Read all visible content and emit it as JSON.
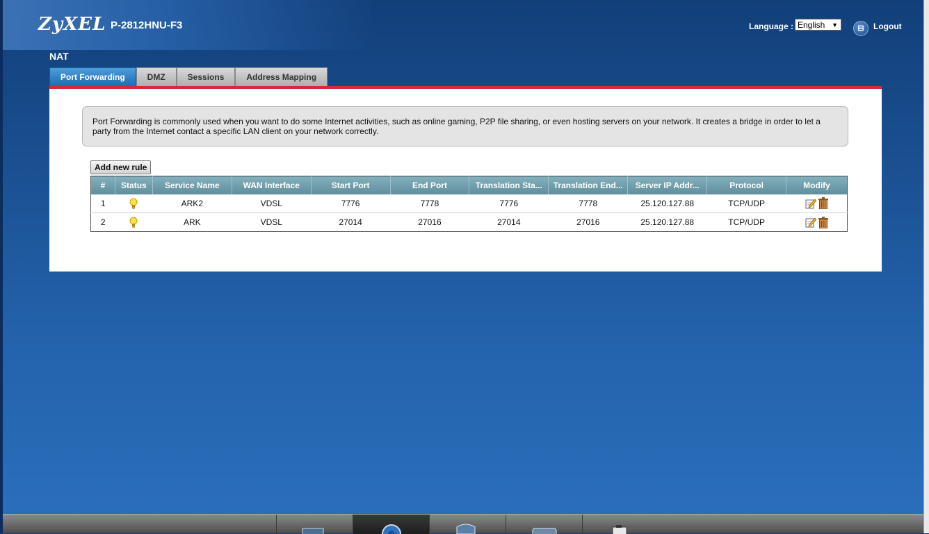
{
  "header": {
    "logo": "ZyXEL",
    "model": "P-2812HNU-F3",
    "language_label": "Language :",
    "language_value": "English",
    "logout_label": "Logout",
    "logout_icon_glyph": "⊟"
  },
  "page_title": "NAT",
  "tabs": [
    {
      "label": "Port Forwarding",
      "active": true
    },
    {
      "label": "DMZ",
      "active": false
    },
    {
      "label": "Sessions",
      "active": false
    },
    {
      "label": "Address Mapping",
      "active": false
    }
  ],
  "info_text": "Port Forwarding is commonly used when you want to do some Internet activities, such as online gaming, P2P file sharing, or even hosting servers on your network. It creates a bridge in order to let a party from the Internet contact a specific LAN client on your network correctly.",
  "add_button_label": "Add new rule",
  "table": {
    "columns": [
      "#",
      "Status",
      "Service Name",
      "WAN Interface",
      "Start Port",
      "End Port",
      "Translation Sta...",
      "Translation End...",
      "Server IP Addr...",
      "Protocol",
      "Modify"
    ],
    "rows": [
      {
        "num": "1",
        "status": "bulb-on-icon",
        "service": "ARK2",
        "wan": "VDSL",
        "start": "7776",
        "end": "7778",
        "tstart": "7776",
        "tend": "7778",
        "ip": "25.120.127.88",
        "protocol": "TCP/UDP"
      },
      {
        "num": "2",
        "status": "bulb-on-icon",
        "service": "ARK",
        "wan": "VDSL",
        "start": "27014",
        "end": "27016",
        "tstart": "27014",
        "tend": "27016",
        "ip": "25.120.127.88",
        "protocol": "TCP/UDP"
      }
    ]
  },
  "colors": {
    "accent_red": "#d6293a",
    "tab_active": "#1f6bb3",
    "table_header": "#6f9dab",
    "background": "#1f5aa0"
  },
  "dock_icons": [
    "monitor-icon",
    "gear-icon",
    "shield-icon",
    "screen-icon",
    "clipboard-icon"
  ]
}
